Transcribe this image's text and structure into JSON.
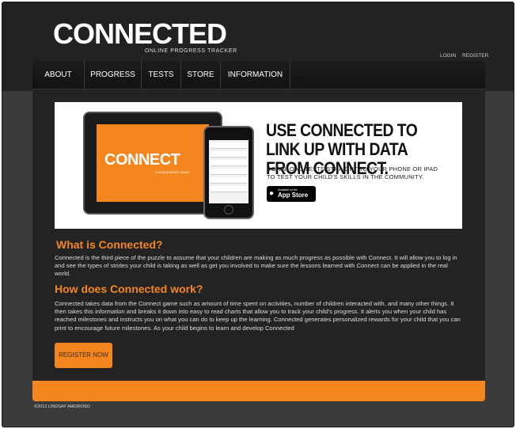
{
  "header": {
    "logo_text": "CONNECTED",
    "logo_subtitle": "ONLINE PROGRESS TRACKER",
    "login_label": "LOGIN",
    "register_label": "REGISTER"
  },
  "nav": {
    "items": [
      {
        "label": "ABOUT"
      },
      {
        "label": "PROGRESS"
      },
      {
        "label": "TESTS"
      },
      {
        "label": "STORE"
      },
      {
        "label": "INFORMATION"
      }
    ]
  },
  "banner": {
    "tablet_logo": "CONNECT",
    "tablet_sub": "A SEQUENCING GAME",
    "headline": "USE CONNECTED TO LINK UP WITH DATA FROM CONNECT.",
    "subtext": "DOWNLOAD TESTS STRAIGHT TO YOUR PHONE OR IPAD TO TEST YOUR CHILD'S SKILLS IN THE COMMUNITY.",
    "appstore_small": "Available on the",
    "appstore_big": "App Store"
  },
  "about": {
    "heading": "What is Connected?",
    "body": "Connected is the third piece of the puzzle to assume that your children are making as much progress as possible with Connect. It will allow you to log in and see the types of strides your child is taking as well as get you involved to make sure the lessons learned with Connect can be applied in the real world."
  },
  "how": {
    "heading": "How does Connected work?",
    "body": "Connected takes data from the Connect game such as amount of time spent on activities, number of children interacted with, and many other things. It then takes this information and breaks it down into easy to read charts that allow you to track your child's progress. It alerts you when your child has reached milestones and instructs you on what you can do to keep up the learning. Connected generates personalized rewards for your child that you can print to encourage future milestones. As your child begins to learn and develop Connected"
  },
  "cta": {
    "register_button": "REGISTER NOW"
  },
  "footer": {
    "copyright": "©2012 LINDSAY AMOROSO"
  },
  "colors": {
    "accent": "#f5861f",
    "background": "#3b3b3b",
    "panel": "#232323"
  }
}
